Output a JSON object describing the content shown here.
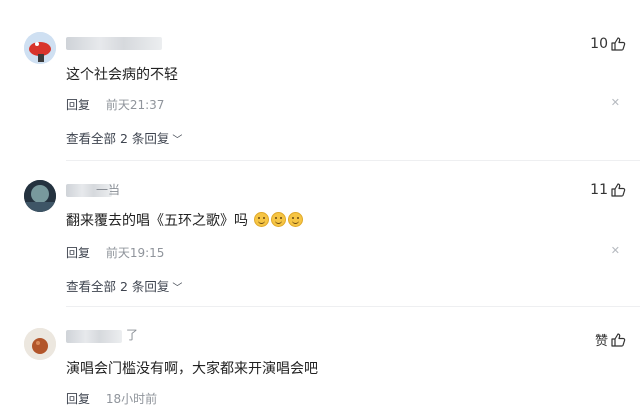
{
  "comments": [
    {
      "name_tail": "",
      "text": "这个社会病的不轻",
      "reply_label": "回复",
      "time": "前天21:37",
      "likes": "10",
      "view_all": "查看全部 2 条回复"
    },
    {
      "name_tail": "一当",
      "text": "翻来覆去的唱《五环之歌》吗",
      "reply_label": "回复",
      "time": "前天19:15",
      "likes": "11",
      "view_all": "查看全部 2 条回复"
    },
    {
      "name_tail": "了",
      "text": "演唱会门槛没有啊，大家都来开演唱会吧",
      "reply_label": "回复",
      "time": "18小时前",
      "likes": "赞",
      "view_all": ""
    }
  ],
  "colors": {
    "text": "#222222",
    "meta": "#8f949b",
    "divider": "#eeeff1"
  },
  "icons": [
    "thumb-up-icon",
    "close-icon",
    "chevron-down-icon",
    "smile-emoji-icon"
  ]
}
